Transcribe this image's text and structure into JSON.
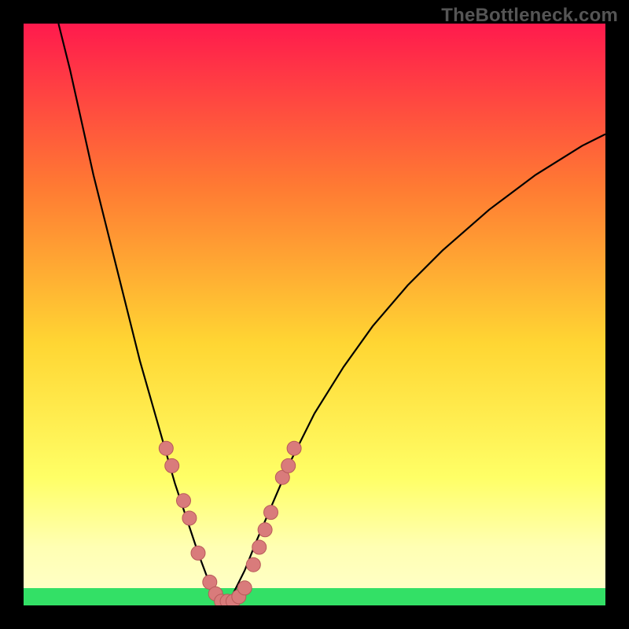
{
  "watermark": "TheBottleneck.com",
  "colors": {
    "bg_black": "#000000",
    "gradient_top": "#ff1a4d",
    "gradient_mid1": "#ff7a33",
    "gradient_mid2": "#ffd633",
    "gradient_mid3": "#ffff66",
    "gradient_bottom_yellow": "#ffffb3",
    "gradient_green": "#33e066",
    "curve": "#000000",
    "dot_fill": "#d97b7b",
    "dot_stroke": "#b85a5a"
  },
  "chart_data": {
    "type": "line",
    "title": "",
    "xlabel": "",
    "ylabel": "",
    "xlim": [
      0,
      100
    ],
    "ylim": [
      0,
      100
    ],
    "series": [
      {
        "name": "curve-left",
        "x": [
          6,
          8,
          10,
          12,
          14,
          16,
          18,
          20,
          22,
          24,
          26,
          28,
          30,
          31.5,
          33,
          34.5
        ],
        "y": [
          100,
          92,
          83,
          74,
          66,
          58,
          50,
          42,
          35,
          28,
          21,
          15,
          9,
          5,
          2,
          0
        ]
      },
      {
        "name": "curve-right",
        "x": [
          34.5,
          36,
          38,
          40,
          43,
          46,
          50,
          55,
          60,
          66,
          72,
          80,
          88,
          96,
          100
        ],
        "y": [
          0,
          2,
          6,
          11,
          18,
          25,
          33,
          41,
          48,
          55,
          61,
          68,
          74,
          79,
          81
        ]
      }
    ],
    "dots": [
      {
        "x": 24.5,
        "y": 27
      },
      {
        "x": 25.5,
        "y": 24
      },
      {
        "x": 27.5,
        "y": 18
      },
      {
        "x": 28.5,
        "y": 15
      },
      {
        "x": 30.0,
        "y": 9
      },
      {
        "x": 32.0,
        "y": 4
      },
      {
        "x": 33.0,
        "y": 2
      },
      {
        "x": 34.0,
        "y": 0.7
      },
      {
        "x": 35.0,
        "y": 0.7
      },
      {
        "x": 36.0,
        "y": 0.7
      },
      {
        "x": 37.0,
        "y": 1.5
      },
      {
        "x": 38.0,
        "y": 3
      },
      {
        "x": 39.5,
        "y": 7
      },
      {
        "x": 40.5,
        "y": 10
      },
      {
        "x": 41.5,
        "y": 13
      },
      {
        "x": 42.5,
        "y": 16
      },
      {
        "x": 44.5,
        "y": 22
      },
      {
        "x": 45.5,
        "y": 24
      },
      {
        "x": 46.5,
        "y": 27
      }
    ]
  }
}
